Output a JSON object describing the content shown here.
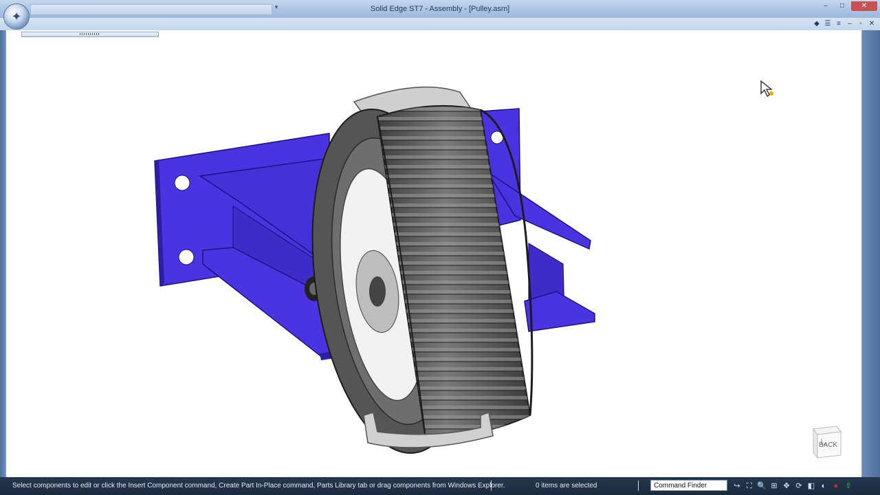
{
  "window": {
    "title": "Solid Edge ST7 - Assembly - [Pulley.asm]",
    "controls": {
      "minimize": "–",
      "maximize": "□",
      "close": "✕"
    },
    "app_button_icon": "solid-edge-logo"
  },
  "ribbon": {
    "icons": [
      "help-icon",
      "menu-icon",
      "options-icon",
      "minimize-icon",
      "restore-icon",
      "close-icon"
    ],
    "glyphs": [
      "◆",
      "☰",
      "≡",
      "–",
      "▫",
      "✕"
    ]
  },
  "viewport": {
    "background": "#ffffff",
    "model_colors": {
      "frame": "#4a33e0",
      "pulley": "#555555",
      "clip": "#c8c8c8",
      "pin": "#c9a64a"
    },
    "view_cube_label": "BACK"
  },
  "statusbar": {
    "prompt": "Select components to edit or click the Insert Component command, Create Part In-Place command, Parts Library tab or drag components from Windows Explorer.",
    "selection_count": "0 items are selected",
    "command_finder": "Command Finder",
    "tool_icons": [
      "arrow-icon",
      "fit-icon",
      "zoom-icon",
      "zoom-area-icon",
      "pan-icon",
      "rotate-icon",
      "view-icon",
      "style-icon",
      "record-icon",
      "upload-icon"
    ],
    "tool_glyphs": [
      "↪",
      "⛶",
      "🔍",
      "⊞",
      "✥",
      "⟳",
      "◧",
      "◐",
      "●",
      "⇧"
    ]
  }
}
